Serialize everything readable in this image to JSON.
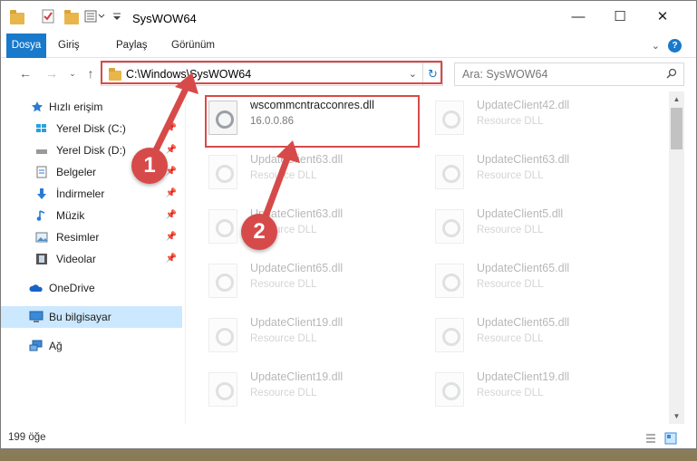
{
  "window": {
    "title": "SysWOW64"
  },
  "ribbon": {
    "tabs": [
      {
        "label": "Dosya",
        "active": true
      },
      {
        "label": "Giriş"
      },
      {
        "label": "Paylaş"
      },
      {
        "label": "Görünüm"
      }
    ],
    "help": "?"
  },
  "address": {
    "path": "C:\\Windows\\SysWOW64"
  },
  "search": {
    "placeholder": "Ara: SysWOW64"
  },
  "sidebar": {
    "items": [
      {
        "label": "Hızlı erişim"
      },
      {
        "label": "Yerel Disk (C:)"
      },
      {
        "label": "Yerel Disk (D:)"
      },
      {
        "label": "Belgeler"
      },
      {
        "label": "İndirmeler"
      },
      {
        "label": "Müzik"
      },
      {
        "label": "Resimler"
      },
      {
        "label": "Videolar"
      },
      {
        "label": "OneDrive"
      },
      {
        "label": "Bu bilgisayar"
      },
      {
        "label": "Ağ"
      }
    ]
  },
  "files": [
    {
      "name": "wscommcntracconres.dll",
      "sub": "16.0.0.86"
    },
    {
      "name": "UpdateClient42.dll",
      "sub": "Resource DLL"
    },
    {
      "name": "UpdateClient63.dll",
      "sub": "Resource DLL"
    },
    {
      "name": "UpdateClient63.dll",
      "sub": "Resource DLL"
    },
    {
      "name": "UpdateClient63.dll",
      "sub": "Resource DLL"
    },
    {
      "name": "UpdateClient5.dll",
      "sub": "Resource DLL"
    },
    {
      "name": "UpdateClient65.dll",
      "sub": "Resource DLL"
    },
    {
      "name": "UpdateClient65.dll",
      "sub": "Resource DLL"
    },
    {
      "name": "UpdateClient19.dll",
      "sub": "Resource DLL"
    },
    {
      "name": "UpdateClient65.dll",
      "sub": "Resource DLL"
    },
    {
      "name": "UpdateClient19.dll",
      "sub": "Resource DLL"
    },
    {
      "name": "UpdateClient19.dll",
      "sub": "Resource DLL"
    }
  ],
  "status": {
    "count": "199 öğe"
  },
  "annotations": {
    "step1": "1",
    "step2": "2",
    "color": "#d74a4a"
  }
}
